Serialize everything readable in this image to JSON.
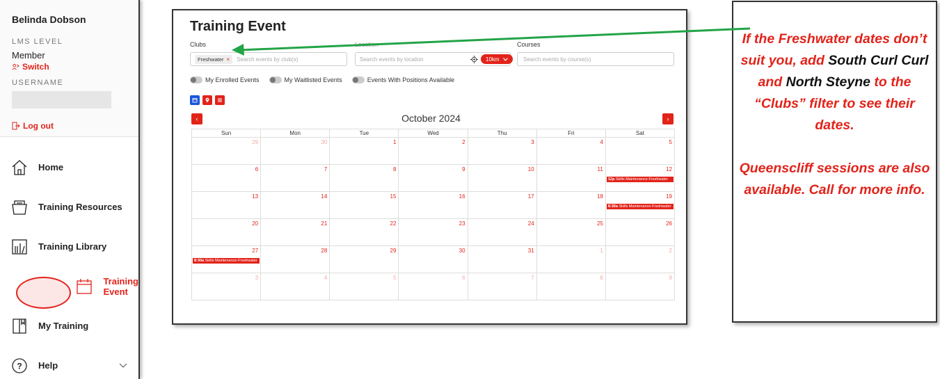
{
  "user": {
    "name": "Belinda Dobson",
    "lms_caption": "LMS LEVEL",
    "level": "Member",
    "switch_label": "Switch",
    "username_caption": "USERNAME",
    "logout_label": "Log out"
  },
  "nav": {
    "home": "Home",
    "resources": "Training Resources",
    "library": "Training Library",
    "event": "Training Event",
    "my_training": "My Training",
    "help": "Help"
  },
  "panel": {
    "title": "Training Event",
    "clubs_label": "Clubs",
    "club_chip": "Freshwater",
    "clubs_placeholder": "Search events by club(s)",
    "location_label": "Location",
    "location_placeholder": "Search events by location",
    "radius": "10km",
    "courses_label": "Courses",
    "courses_placeholder": "Search events by course(s)",
    "toggle_enrolled": "My Enrolled Events",
    "toggle_waitlisted": "My Waitlisted Events",
    "toggle_available": "Events With Positions Available",
    "month": "October 2024"
  },
  "calendar": {
    "days": [
      "Sun",
      "Mon",
      "Tue",
      "Wed",
      "Thu",
      "Fri",
      "Sat"
    ],
    "weeks": [
      [
        {
          "d": "29",
          "m": true
        },
        {
          "d": "30",
          "m": true
        },
        {
          "d": "1"
        },
        {
          "d": "2"
        },
        {
          "d": "3"
        },
        {
          "d": "4"
        },
        {
          "d": "5"
        }
      ],
      [
        {
          "d": "6"
        },
        {
          "d": "7"
        },
        {
          "d": "8"
        },
        {
          "d": "9"
        },
        {
          "d": "10"
        },
        {
          "d": "11"
        },
        {
          "d": "12",
          "t": "12p",
          "e": "Skills Maintenance-Freshwater"
        }
      ],
      [
        {
          "d": "13"
        },
        {
          "d": "14"
        },
        {
          "d": "15"
        },
        {
          "d": "16"
        },
        {
          "d": "17"
        },
        {
          "d": "18"
        },
        {
          "d": "19",
          "t": "8:30a",
          "e": "Skills Maintenance-Freshwater"
        }
      ],
      [
        {
          "d": "20"
        },
        {
          "d": "21"
        },
        {
          "d": "22"
        },
        {
          "d": "23"
        },
        {
          "d": "24"
        },
        {
          "d": "25"
        },
        {
          "d": "26"
        }
      ],
      [
        {
          "d": "27",
          "t": "8:30a",
          "e": "Skills Maintenance-Freshwater"
        },
        {
          "d": "28"
        },
        {
          "d": "29"
        },
        {
          "d": "30"
        },
        {
          "d": "31"
        },
        {
          "d": "1",
          "m": true
        },
        {
          "d": "2",
          "m": true
        }
      ],
      [
        {
          "d": "3",
          "m": true
        },
        {
          "d": "4",
          "m": true
        },
        {
          "d": "5",
          "m": true
        },
        {
          "d": "6",
          "m": true
        },
        {
          "d": "7",
          "m": true
        },
        {
          "d": "8",
          "m": true
        },
        {
          "d": "9",
          "m": true
        }
      ]
    ]
  },
  "note": {
    "p1_a": "If the Freshwater dates don’t suit you, add ",
    "p1_b": "South Curl Curl",
    "p1_c": " and ",
    "p1_d": "North Steyne",
    "p1_e": " to the “Clubs” filter to see their dates.",
    "p2": "Queenscliff sessions are also available. Call for more info."
  },
  "colors": {
    "accent": "#e2231a",
    "blue": "#1a56db",
    "arrow": "#22a447"
  }
}
